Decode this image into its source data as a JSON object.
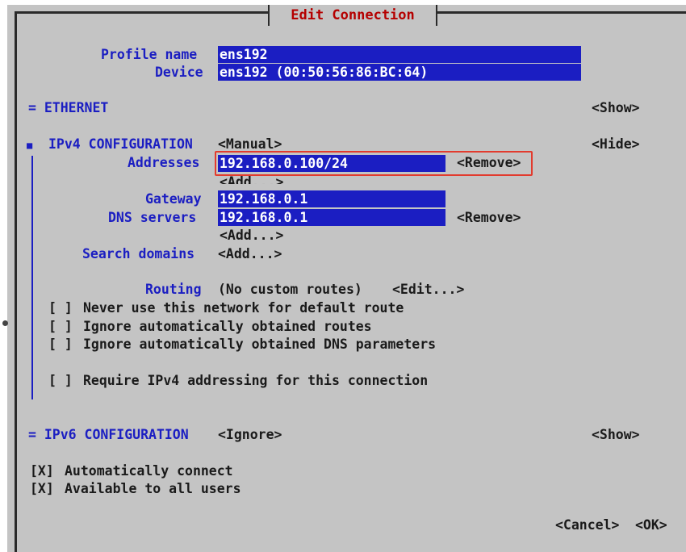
{
  "dialog": {
    "title": "Edit Connection"
  },
  "profile": {
    "name_label": "Profile name",
    "name_value": "ens192",
    "device_label": "Device",
    "device_value": "ens192 (00:50:56:86:BC:64)"
  },
  "ethernet": {
    "label": "= ETHERNET",
    "toggle": "<Show>"
  },
  "ipv4": {
    "label": "IPv4 CONFIGURATION",
    "marker": "■",
    "method": "<Manual>",
    "toggle": "<Hide>",
    "addresses_label": "Addresses",
    "address_value": "192.168.0.100/24",
    "address_remove": "<Remove>",
    "address_add": "<Add...>",
    "gateway_label": "Gateway",
    "gateway_value": "192.168.0.1",
    "dns_label": "DNS servers",
    "dns_value": "192.168.0.1",
    "dns_remove": "<Remove>",
    "dns_add": "<Add...>",
    "search_label": "Search domains",
    "search_add": "<Add...>",
    "routing_label": "Routing",
    "routing_value": "(No custom routes)",
    "routing_edit": "<Edit...>",
    "checks": [
      {
        "box": "[ ]",
        "label": "Never use this network for default route"
      },
      {
        "box": "[ ]",
        "label": "Ignore automatically obtained routes"
      },
      {
        "box": "[ ]",
        "label": "Ignore automatically obtained DNS parameters"
      },
      {
        "box": "[ ]",
        "label": "Require IPv4 addressing for this connection"
      }
    ]
  },
  "ipv6": {
    "label": "= IPv6 CONFIGURATION",
    "method": "<Ignore>",
    "toggle": "<Show>"
  },
  "options": [
    {
      "box": "[X]",
      "label": "Automatically connect"
    },
    {
      "box": "[X]",
      "label": "Available to all users"
    }
  ],
  "buttons": {
    "cancel": "<Cancel>",
    "ok": "<OK>"
  },
  "colors": {
    "field_bg": "#1b1ec2",
    "title": "#b50000",
    "background": "#c4c4c4",
    "highlight_box": "#e23b2e"
  }
}
